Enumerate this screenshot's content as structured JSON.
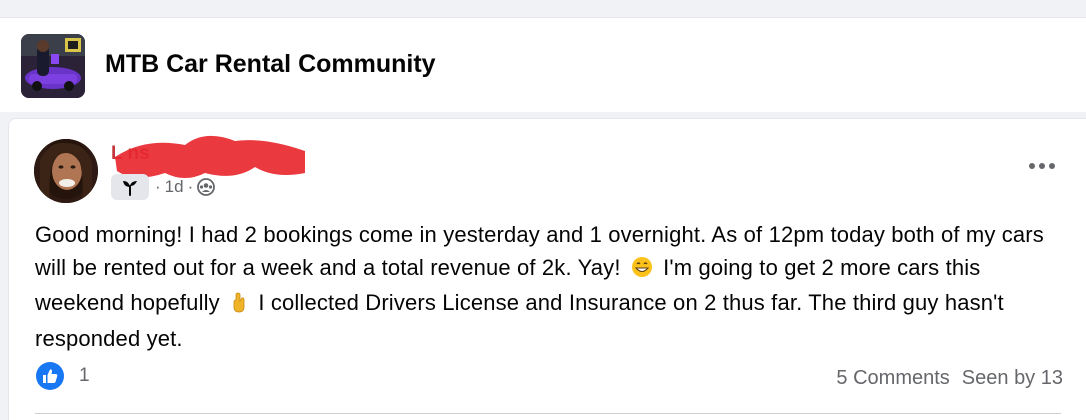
{
  "group": {
    "name": "MTB Car Rental Community"
  },
  "post": {
    "author_name": "L                  ns",
    "badge_icon": "new-member-sprout-icon",
    "time": "1d",
    "separator": "·",
    "audience_icon": "group-members-icon",
    "body": {
      "part1": "Good morning! I had 2 bookings come in yesterday and 1 overnight. As of 12pm today both of my cars will be rented out for a week and a total revenue of 2k. Yay!",
      "part2": "I'm going to get 2 more cars this weekend hopefully",
      "part3": "I collected Drivers License and Insurance on 2 thus far. The third guy hasn't responded yet."
    },
    "reactions": {
      "like_count": "1"
    },
    "stats": {
      "comments": "5 Comments",
      "seen_by": "Seen by 13"
    }
  },
  "colors": {
    "like_blue": "#1877f2",
    "redaction_red": "#e8282f",
    "meta_gray": "#65676b"
  }
}
